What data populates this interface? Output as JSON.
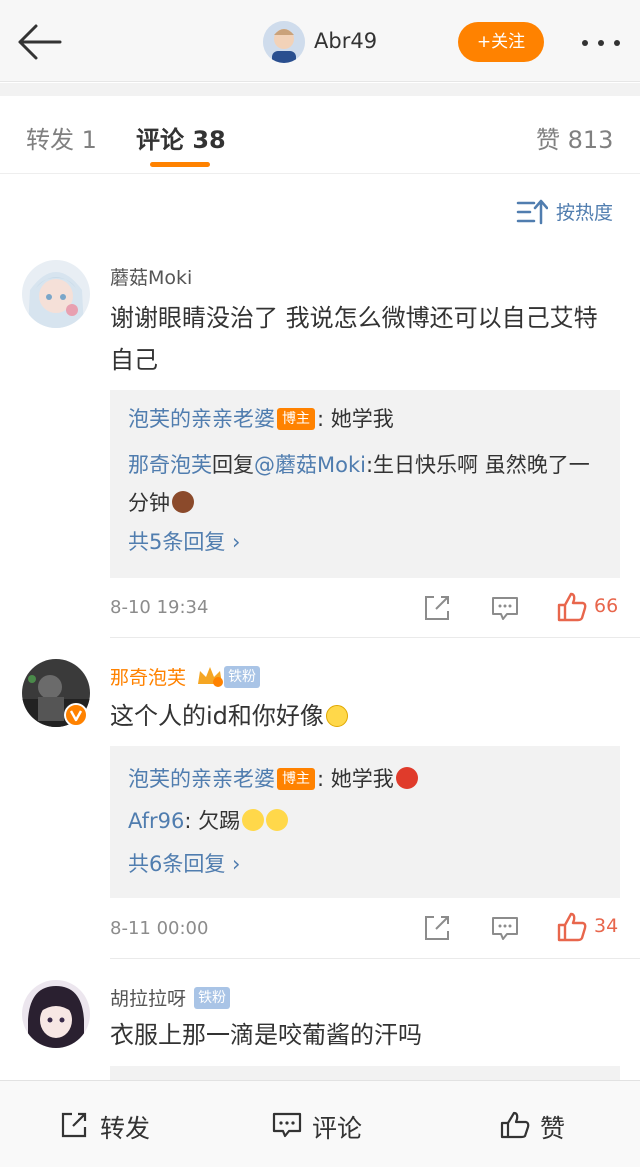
{
  "header": {
    "username": "Abr49",
    "follow_label": "+关注"
  },
  "tabs": [
    {
      "label": "转发 1"
    },
    {
      "label": "评论 38"
    },
    {
      "label": "赞 813"
    }
  ],
  "sort": {
    "label": "按热度"
  },
  "comments": [
    {
      "name": "蘑菇Moki",
      "text": "谢谢眼睛没治了 我说怎么微博还可以自己艾特自己",
      "replies": [
        {
          "author": "泡芙的亲亲老婆",
          "tag": "博主",
          "text": ": 她学我"
        },
        {
          "author": "那奇泡芙",
          "verb": "回复",
          "mention": "@蘑菇Moki",
          "text": ":生日快乐啊  虽然晚了一分钟"
        }
      ],
      "more_replies": "共5条回复",
      "time": "8-10 19:34",
      "likes": "66"
    },
    {
      "name": "那奇泡芙",
      "badge": "铁粉",
      "text": "这个人的id和你好像",
      "replies": [
        {
          "author": "泡芙的亲亲老婆",
          "tag": "博主",
          "text": ": 她学我"
        },
        {
          "author": "Afr96",
          "text": ": 欠踢"
        }
      ],
      "more_replies": "共6条回复",
      "time": "8-11 00:00",
      "likes": "34"
    },
    {
      "name": "胡拉拉呀",
      "badge": "铁粉",
      "text": "衣服上那一滴是咬葡酱的汗吗"
    }
  ],
  "bottom_bar": {
    "repost": "转发",
    "comment": "评论",
    "like": "赞"
  },
  "colors": {
    "accent": "#ff8200",
    "link": "#507daf",
    "like": "#e8664c"
  }
}
